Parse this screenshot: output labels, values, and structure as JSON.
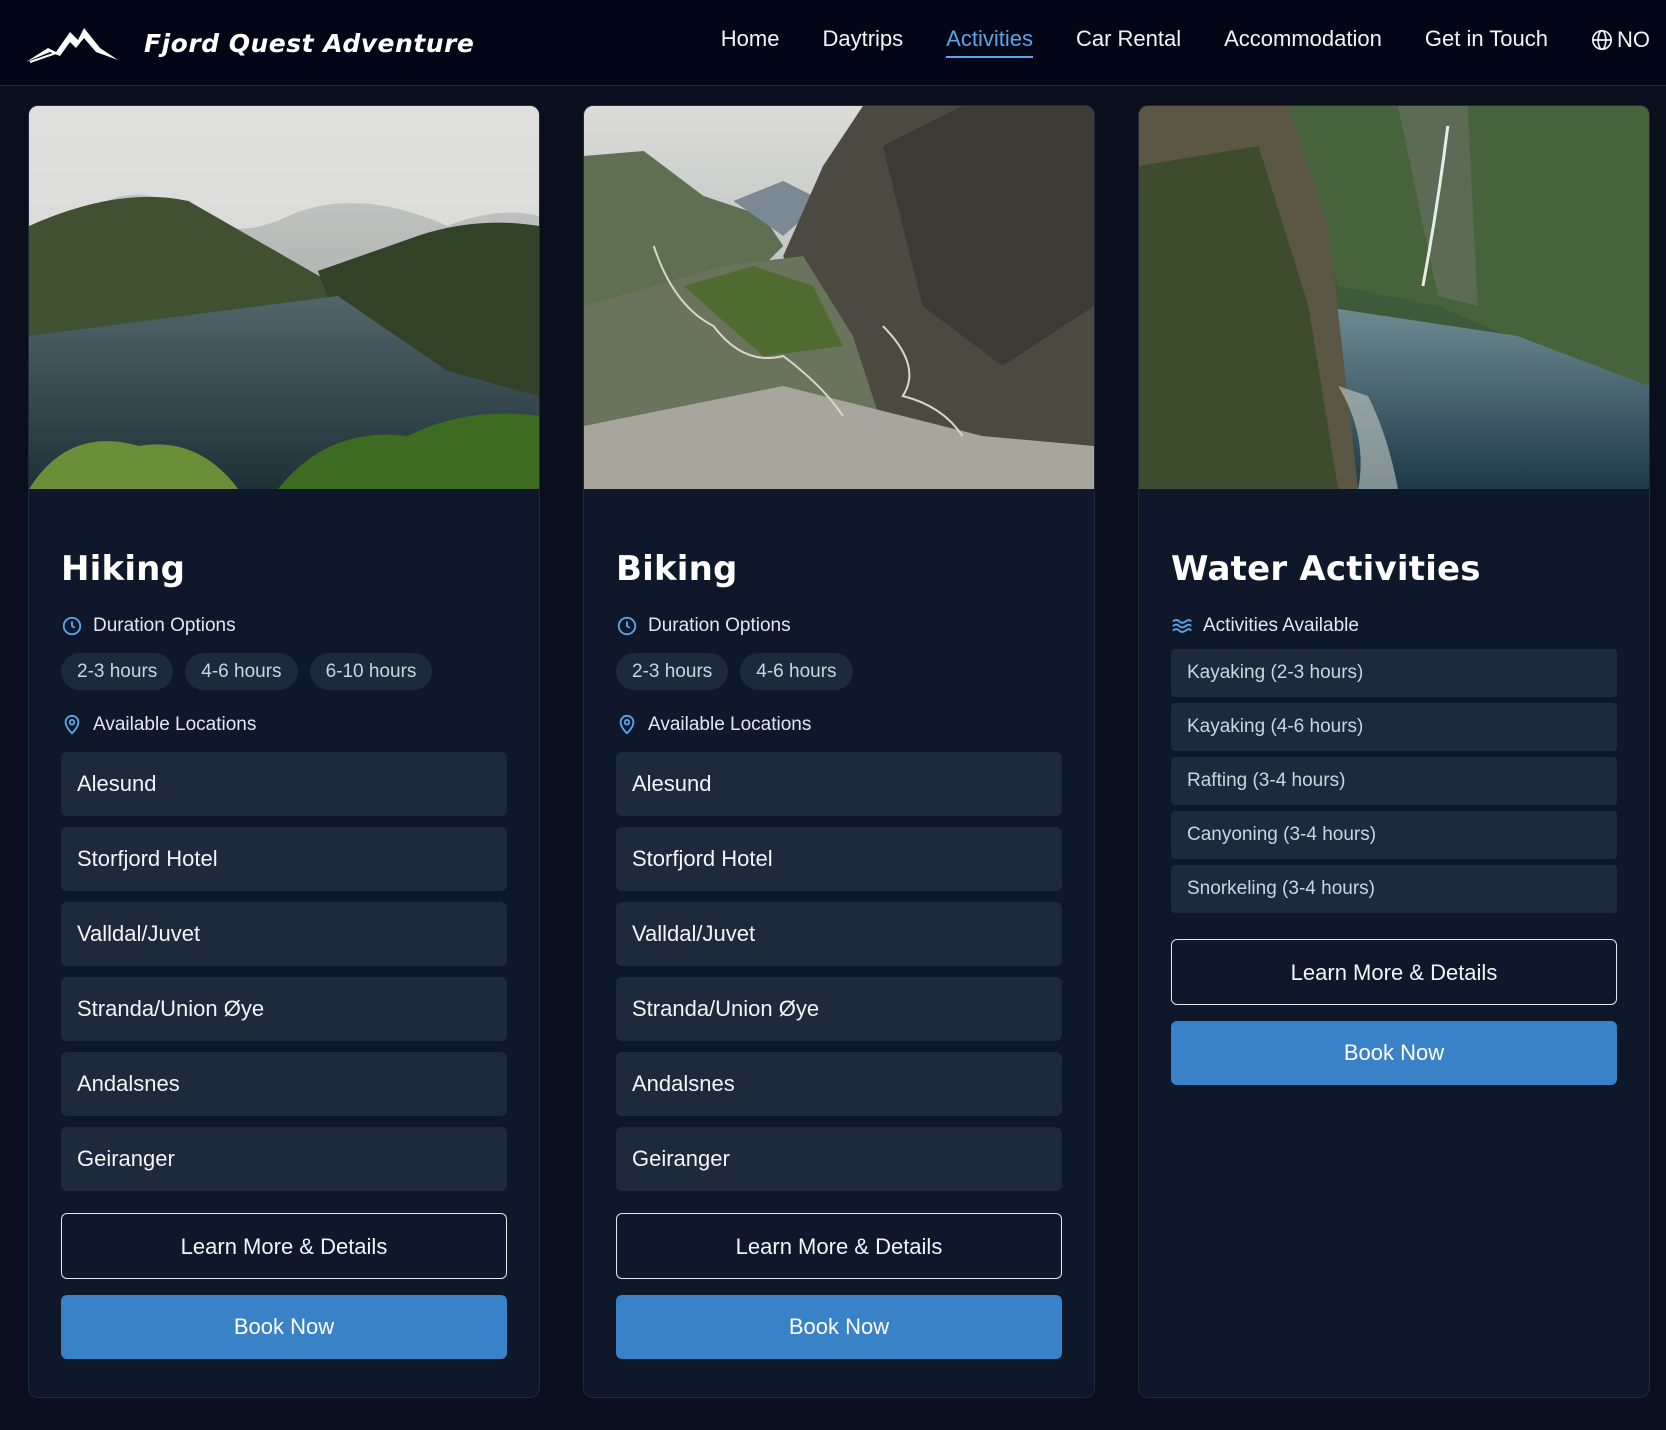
{
  "header": {
    "brand": "Fjord Quest Adventure",
    "logo_icon": "mountain-logo-icon",
    "nav": [
      {
        "label": "Home",
        "active": false
      },
      {
        "label": "Daytrips",
        "active": false
      },
      {
        "label": "Activities",
        "active": true
      },
      {
        "label": "Car Rental",
        "active": false
      },
      {
        "label": "Accommodation",
        "active": false
      },
      {
        "label": "Get in Touch",
        "active": false
      }
    ],
    "language": "NO",
    "language_icon": "globe-icon",
    "active_color": "#5aa6ea"
  },
  "cards": [
    {
      "title": "Hiking",
      "image": "fjord-overlook-photo",
      "duration_label": "Duration Options",
      "duration_icon": "clock-icon",
      "durations": [
        "2-3 hours",
        "4-6 hours",
        "6-10 hours"
      ],
      "locations_label": "Available Locations",
      "locations_icon": "map-pin-icon",
      "locations": [
        "Alesund",
        "Storfjord Hotel",
        "Valldal/Juvet",
        "Stranda/Union Øye",
        "Andalsnes",
        "Geiranger"
      ],
      "learn_more": "Learn More & Details",
      "book_now": "Book Now"
    },
    {
      "title": "Biking",
      "image": "mountain-road-valley-photo",
      "duration_label": "Duration Options",
      "duration_icon": "clock-icon",
      "durations": [
        "2-3 hours",
        "4-6 hours"
      ],
      "locations_label": "Available Locations",
      "locations_icon": "map-pin-icon",
      "locations": [
        "Alesund",
        "Storfjord Hotel",
        "Valldal/Juvet",
        "Stranda/Union Øye",
        "Andalsnes",
        "Geiranger"
      ],
      "learn_more": "Learn More & Details",
      "book_now": "Book Now"
    },
    {
      "title": "Water Activities",
      "image": "fjord-waterfall-cliffs-photo",
      "activities_label": "Activities Available",
      "activities_icon": "waves-icon",
      "activities": [
        "Kayaking (2-3 hours)",
        "Kayaking (4-6 hours)",
        "Rafting (3-4 hours)",
        "Canyoning (3-4 hours)",
        "Snorkeling (3-4 hours)"
      ],
      "learn_more": "Learn More & Details",
      "book_now": "Book Now"
    }
  ],
  "colors": {
    "background": "#0a0f1d",
    "card": "#0f172a",
    "list_item": "#1e293b",
    "primary_button": "#3a82c8",
    "icon_accent": "#5aa6ea"
  }
}
